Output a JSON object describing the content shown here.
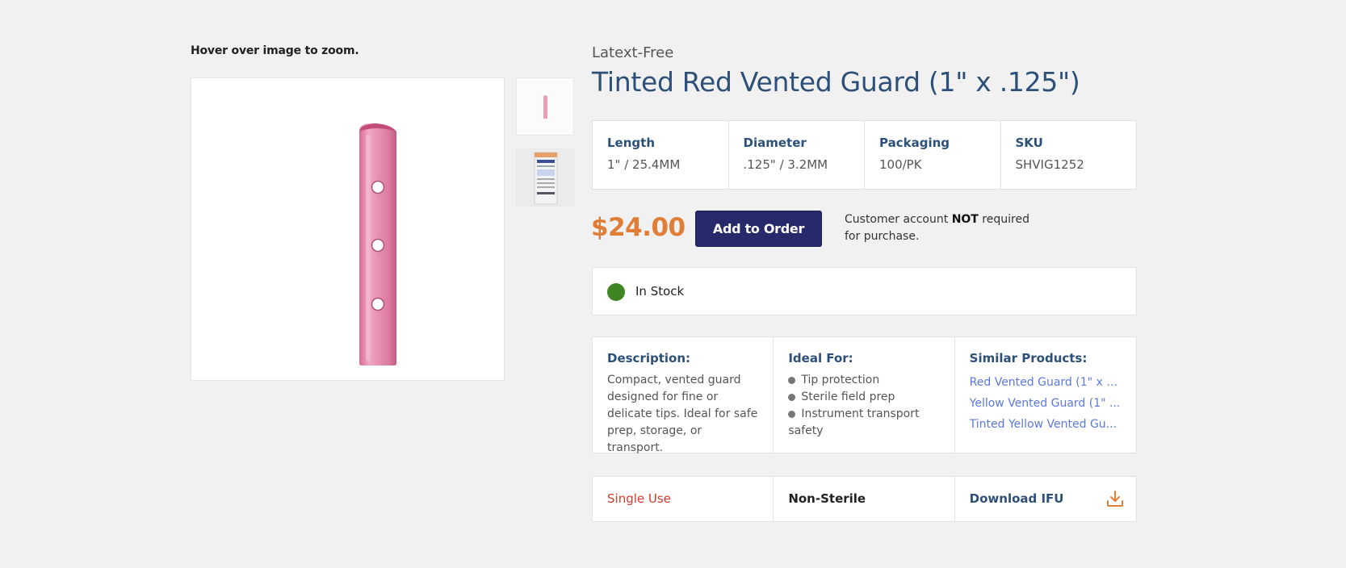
{
  "gallery": {
    "hint": "Hover over image to zoom."
  },
  "product": {
    "brand": "Latext-Free",
    "title": "Tinted Red Vented Guard (1\" x .125\")",
    "specs": [
      {
        "label": "Length",
        "value": "1\" / 25.4MM"
      },
      {
        "label": "Diameter",
        "value": ".125\" / 3.2MM"
      },
      {
        "label": "Packaging",
        "value": "100/PK"
      },
      {
        "label": "SKU",
        "value": "SHVIG1252"
      }
    ],
    "price": "$24.00",
    "add_to_order_label": "Add to Order",
    "account_note_pre": "Customer account ",
    "account_note_bold": "NOT",
    "account_note_post": " required for purchase.",
    "stock_status": "In Stock",
    "stock_color": "#3f8522",
    "accent_color": "#e07d36",
    "button_color": "#262a6b"
  },
  "info": {
    "description_heading": "Description:",
    "description": "Compact, vented guard designed for fine or delicate tips. Ideal for safe prep, storage, or transport.",
    "ideal_heading": "Ideal For:",
    "ideal_items": [
      "Tip protection",
      "Sterile field prep",
      "Instrument transport",
      "safety"
    ],
    "similar_heading": "Similar Products:",
    "similar_items": [
      "Red Vented Guard (1\" x .1...",
      "Yellow Vented Guard (1\" ...",
      "Tinted Yellow Vented Gu..."
    ]
  },
  "footer": {
    "single_use": "Single Use",
    "non_sterile": "Non-Sterile",
    "download_label": "Download IFU",
    "download_icon": "download-icon"
  }
}
